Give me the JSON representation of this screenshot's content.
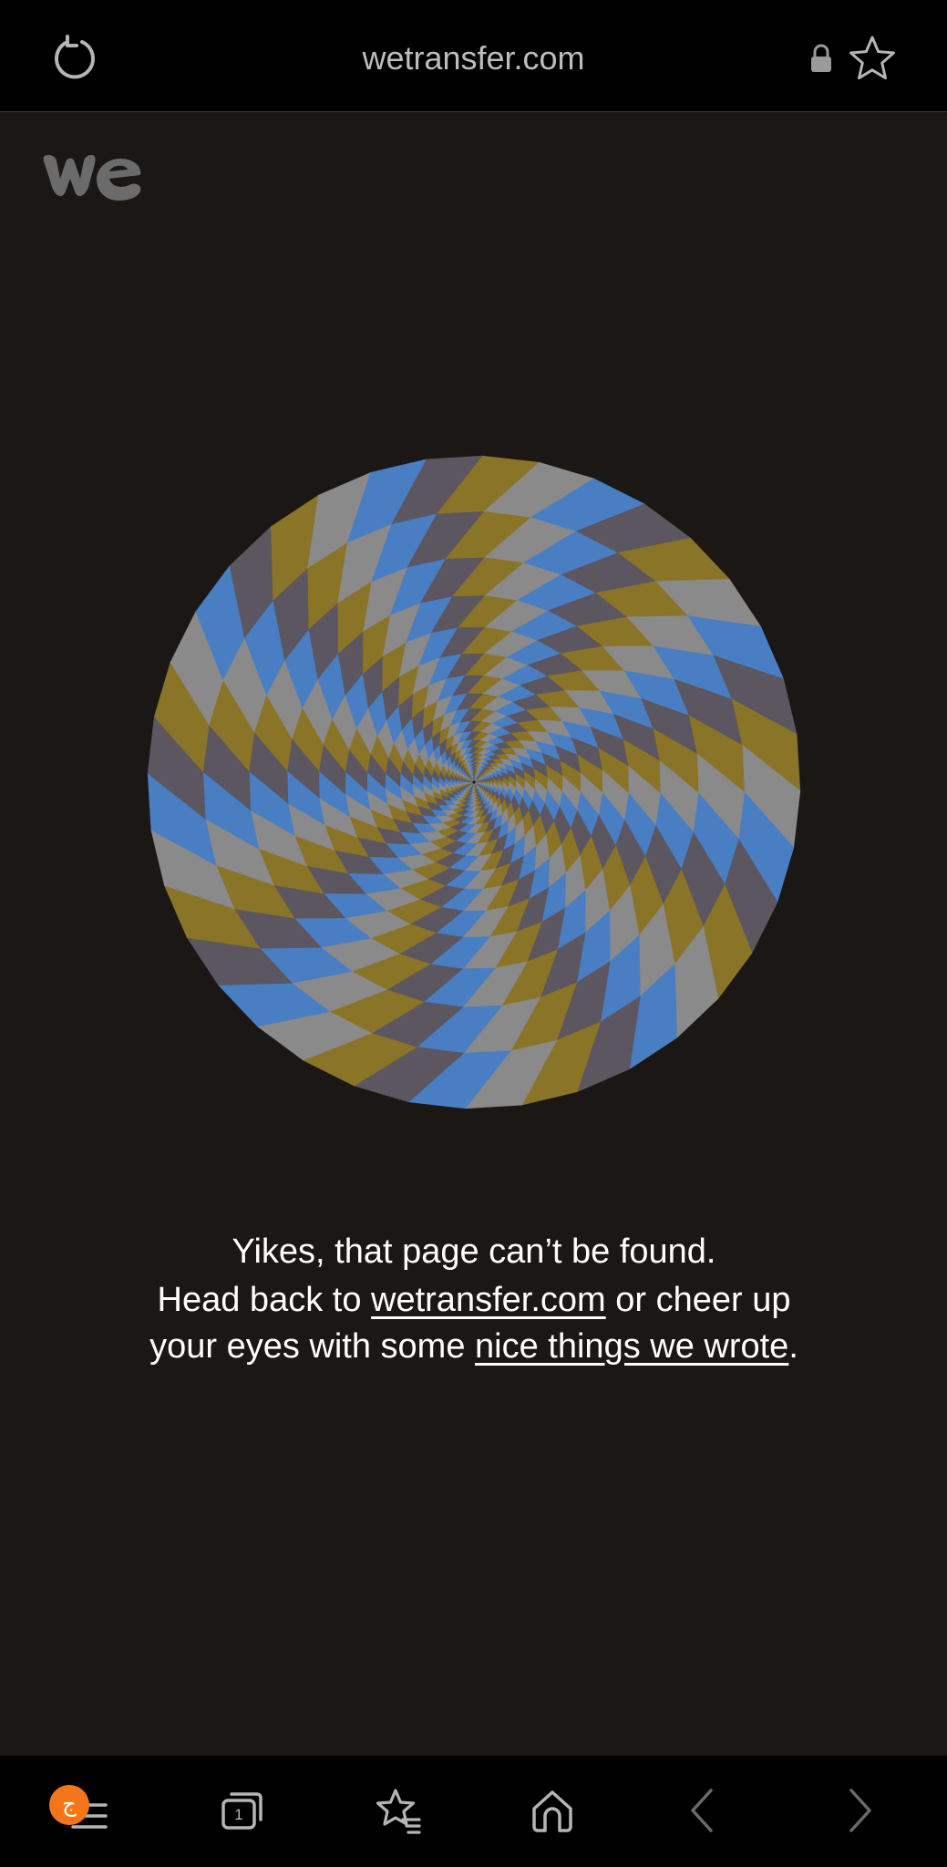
{
  "browser": {
    "url": "wetransfer.com",
    "tab_count": "1",
    "menu_badge": "ج"
  },
  "icons": {
    "reload": "reload-icon",
    "lock": "lock-icon",
    "bookmark": "star-icon",
    "menu": "menu-icon",
    "tabs": "tabs-icon",
    "bookmarks": "bookmarks-icon",
    "home": "home-icon",
    "back": "chevron-left-icon",
    "forward": "chevron-right-icon"
  },
  "page": {
    "headline": "Yikes, that page can’t be found.",
    "text_1": "Head back to ",
    "link_1": "wetransfer.com",
    "text_2": " or cheer up your eyes with some ",
    "link_2": "nice things we wrote",
    "text_3": "."
  },
  "colors": {
    "spiral": [
      "#8a7428",
      "#8a8a8a",
      "#4a7ec2",
      "#5b5660"
    ],
    "badge": "#f5761a",
    "background": "#1a1714"
  }
}
